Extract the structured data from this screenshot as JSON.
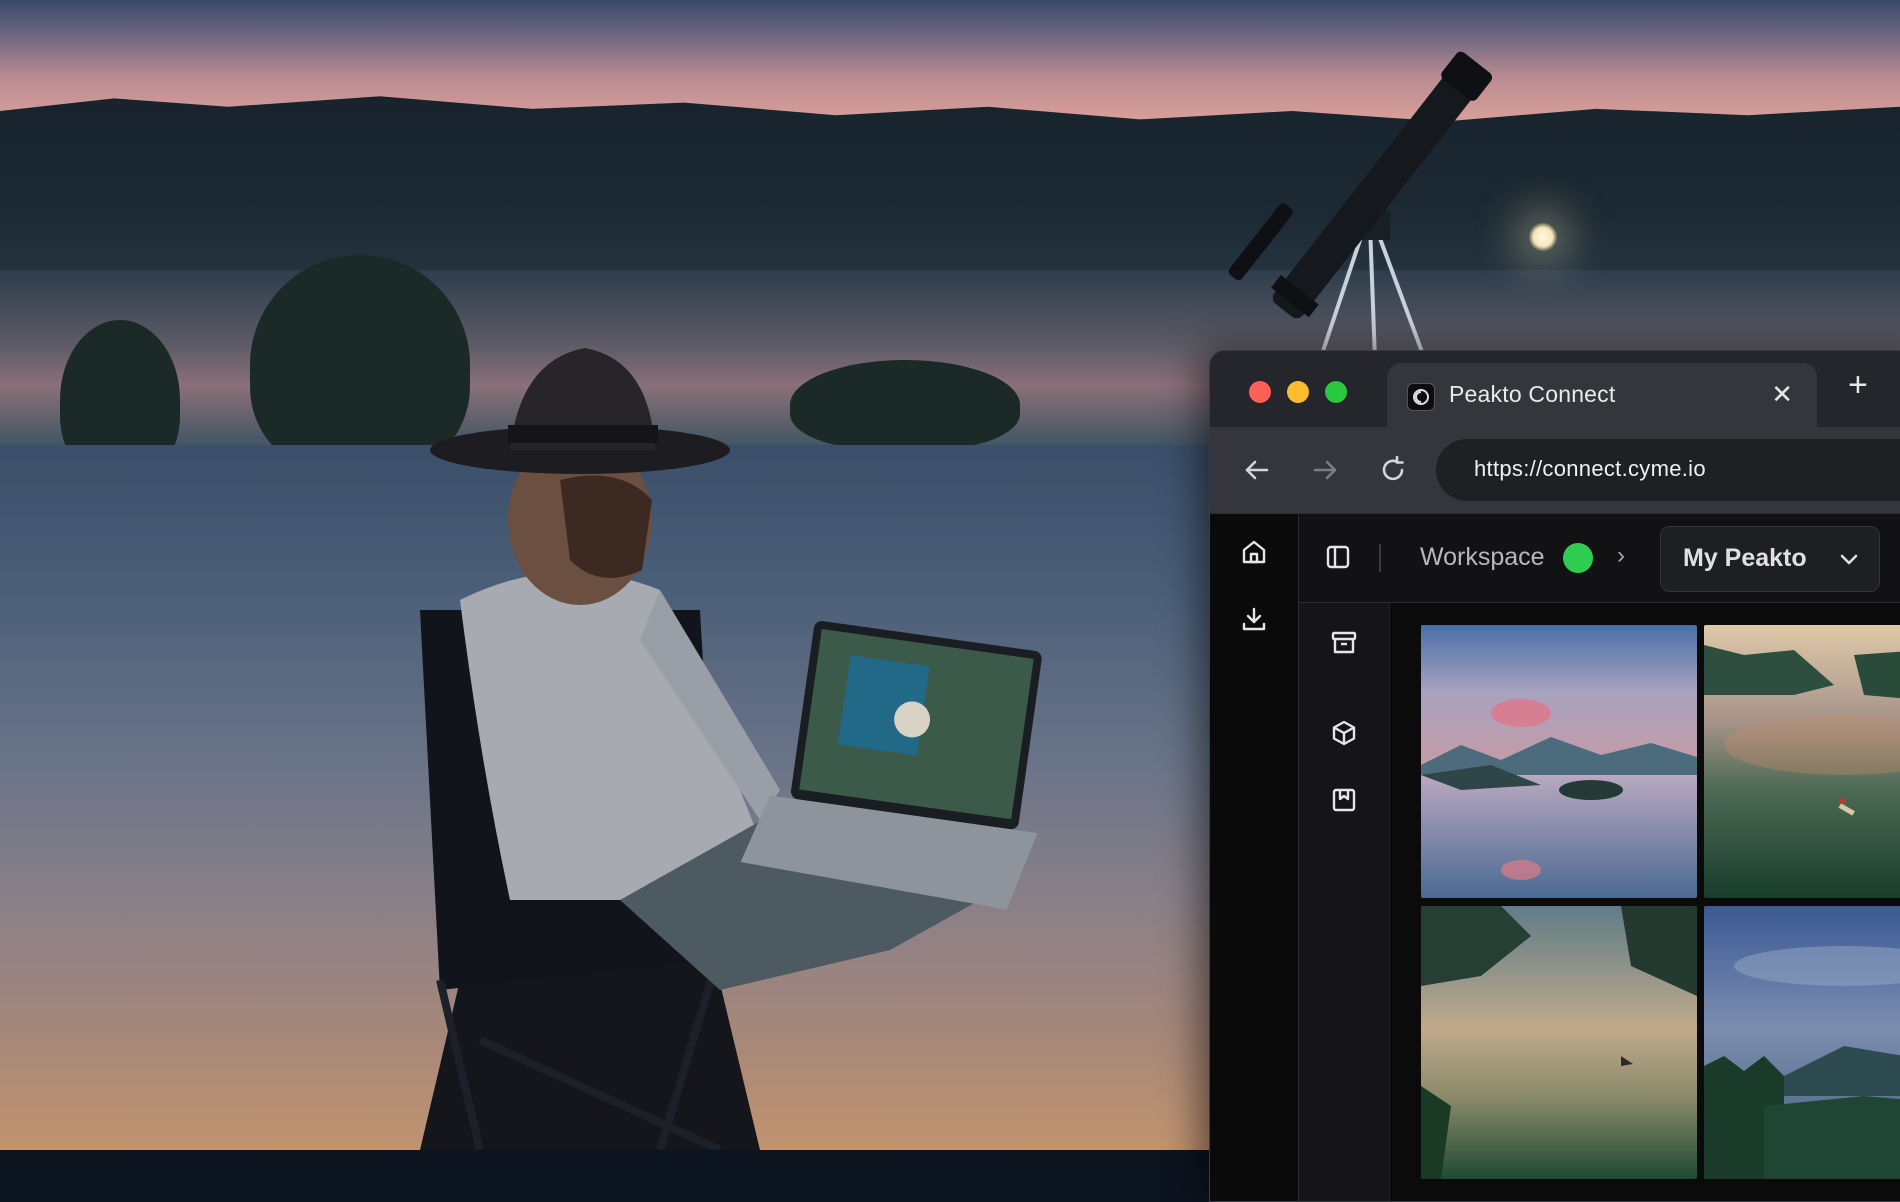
{
  "browser": {
    "tab": {
      "title": "Peakto Connect",
      "favicon_icon": "peakto-logo-icon",
      "close_icon": "close-icon"
    },
    "new_tab_icon": "plus-icon",
    "nav": {
      "back_icon": "arrow-left-icon",
      "forward_icon": "arrow-right-icon",
      "reload_icon": "reload-icon"
    },
    "url": "https://connect.cyme.io",
    "traffic_colors": {
      "close": "#fe5f57",
      "minimize": "#febc2e",
      "maximize": "#28c840"
    }
  },
  "app": {
    "rail": [
      {
        "icon": "home-icon"
      },
      {
        "icon": "download-icon"
      }
    ],
    "topbar": {
      "sidebar_toggle_icon": "sidebar-toggle-icon",
      "workspace_label": "Workspace",
      "workspace_status_color": "#2ecc4f",
      "crumb_chevron": "›",
      "dropdown_label": "My Peakto",
      "dropdown_icon": "chevron-down-icon"
    },
    "subrail": [
      {
        "icon": "archive-icon"
      },
      {
        "icon": "cube-icon"
      },
      {
        "icon": "bookmark-icon"
      }
    ],
    "thumbnails": [
      {
        "name": "misty-lake-island"
      },
      {
        "name": "canoe-on-lake"
      },
      {
        "name": "calm-lake-sunset"
      },
      {
        "name": "forest-valley-sky"
      }
    ]
  }
}
